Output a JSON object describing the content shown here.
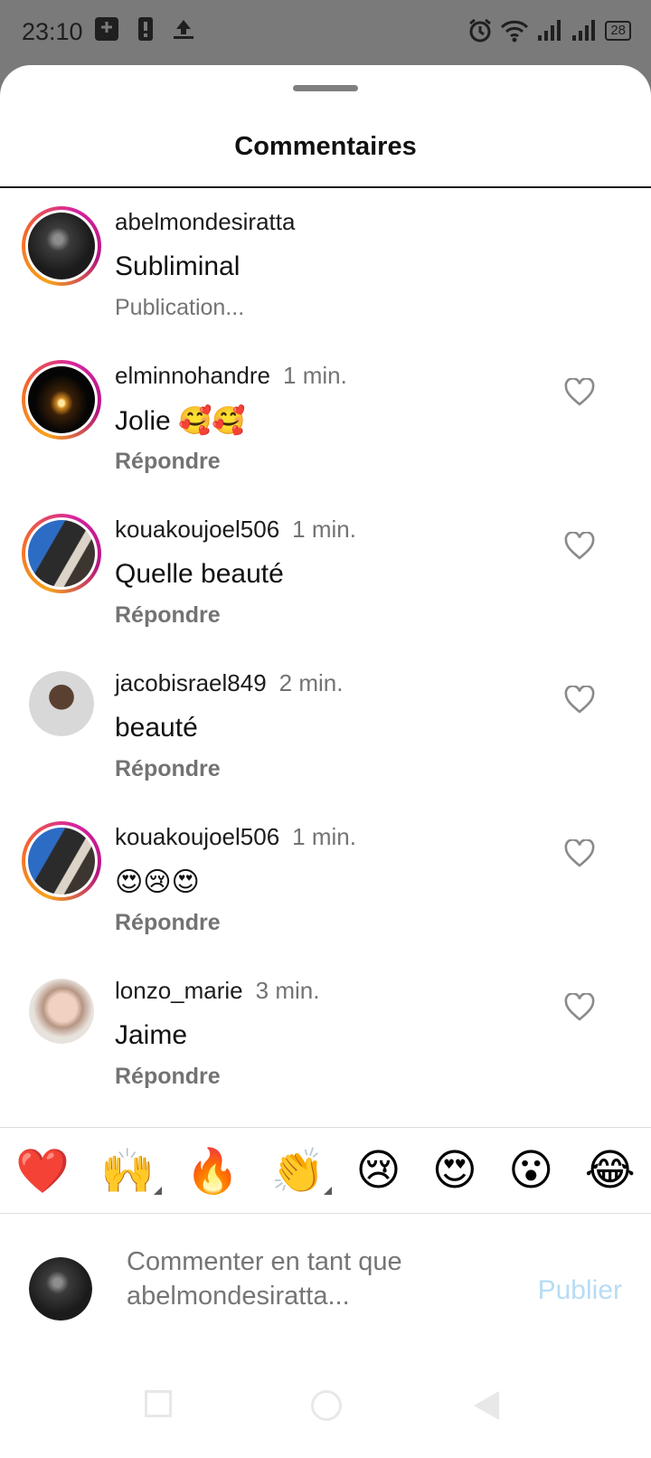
{
  "status_bar": {
    "time": "23:10",
    "battery": "28"
  },
  "header": {
    "title": "Commentaires"
  },
  "comments": [
    {
      "username": "abelmondesiratta",
      "time": "",
      "text": "Subliminal",
      "action": "Publication...",
      "avatar": "dark-photo",
      "story_ring": true
    },
    {
      "username": "elminnohandre",
      "time": "1 min.",
      "text": "Jolie 🥰🥰",
      "action": "Répondre",
      "avatar": "candle-photo",
      "story_ring": true
    },
    {
      "username": "kouakoujoel506",
      "time": "1 min.",
      "text": "Quelle beauté",
      "action": "Répondre",
      "avatar": "duo-photo",
      "story_ring": true
    },
    {
      "username": "jacobisrael849",
      "time": "2 min.",
      "text": "beauté",
      "action": "Répondre",
      "avatar": "man-photo",
      "story_ring": false
    },
    {
      "username": "kouakoujoel506",
      "time": "1 min.",
      "text": "😍😢😍",
      "action": "Répondre",
      "avatar": "duo-photo",
      "story_ring": true
    },
    {
      "username": "lonzo_marie",
      "time": "3 min.",
      "text": "Jaime",
      "action": "Répondre",
      "avatar": "woman-photo",
      "story_ring": false
    }
  ],
  "quick_reactions": [
    "❤️",
    "🙌",
    "🔥",
    "👏",
    "😢",
    "😍",
    "😮",
    "😂"
  ],
  "compose": {
    "placeholder": "Commenter en tant que abelmondesiratta...",
    "publish_label": "Publier"
  },
  "colors": {
    "publish_disabled": "#b7dcf5",
    "meta_text": "#737373",
    "story_ring": [
      "#f7a21b",
      "#d6249f"
    ]
  }
}
